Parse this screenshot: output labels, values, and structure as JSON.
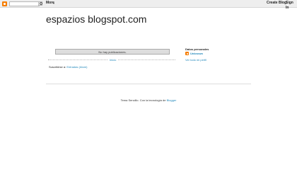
{
  "navbar": {
    "more_label": "More",
    "create_blog_label": "Create Blog",
    "sign_in_label": "Sign In"
  },
  "header": {
    "title": "espazios blogspot.com"
  },
  "main": {
    "status_message": "No hay publicaciones.",
    "home_link": "Inicio",
    "subscribe_prefix": "Suscribirse a:",
    "subscribe_link": "Entradas (Atom)"
  },
  "sidebar": {
    "profile_heading": "Datos personales",
    "profile_name": "Unknown",
    "profile_link": "Ver todo mi perfil"
  },
  "footer": {
    "text_prefix": "Tema Sencillo. Con la tecnología de",
    "link": "Blogger"
  },
  "colors": {
    "link": "#2288bb",
    "blogger_orange": "#f57d00"
  }
}
